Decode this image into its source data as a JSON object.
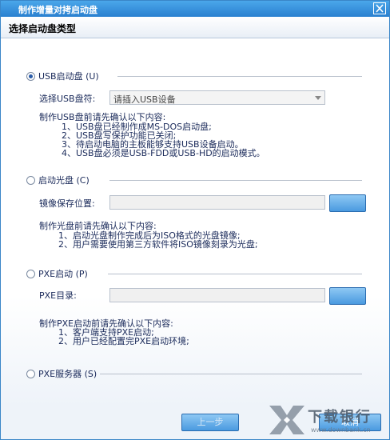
{
  "window": {
    "title": "制作增量对拷启动盘"
  },
  "header": {
    "title": "选择启动盘类型"
  },
  "usb": {
    "label": "USB启动盘 (U)",
    "drive_label": "选择USB盘符:",
    "drive_value": "请插入USB设备",
    "notes_title": "制作USB盘前请先确认以下内容:",
    "notes": [
      "1、USB盘已经制作成MS-DOS启动盘;",
      "2、USB盘写保护功能已关闭;",
      "3、待启动电脑的主板能够支持USB设备启动。",
      "4、USB盘必须是USB-FDD或USB-HD的启动模式。"
    ]
  },
  "cd": {
    "label": "启动光盘 (C)",
    "path_label": "镜像保存位置:",
    "notes_title": "制作光盘前请先确认以下内容:",
    "notes": [
      "1、启动光盘制作完成后为ISO格式的光盘镜像;",
      "2、用户需要使用第三方软件将ISO镜像刻录为光盘;"
    ]
  },
  "pxe": {
    "label": "PXE启动 (P)",
    "dir_label": "PXE目录:",
    "notes_title": "制作PXE启动前请先确认以下内容:",
    "notes": [
      "1、客户端支持PXE启动;",
      "2、用户已经配置完PXE启动环境;"
    ]
  },
  "pxe_server": {
    "label": "PXE服务器 (S)"
  },
  "footer": {
    "prev_label": "上一步",
    "next_label": "取消"
  },
  "watermark": {
    "brand": "下载银行",
    "url": "www.downbank.cn"
  },
  "colors": {
    "titlebar": "#2a80d0",
    "button": "#4a9ae0",
    "text": "#1a2a5a"
  }
}
